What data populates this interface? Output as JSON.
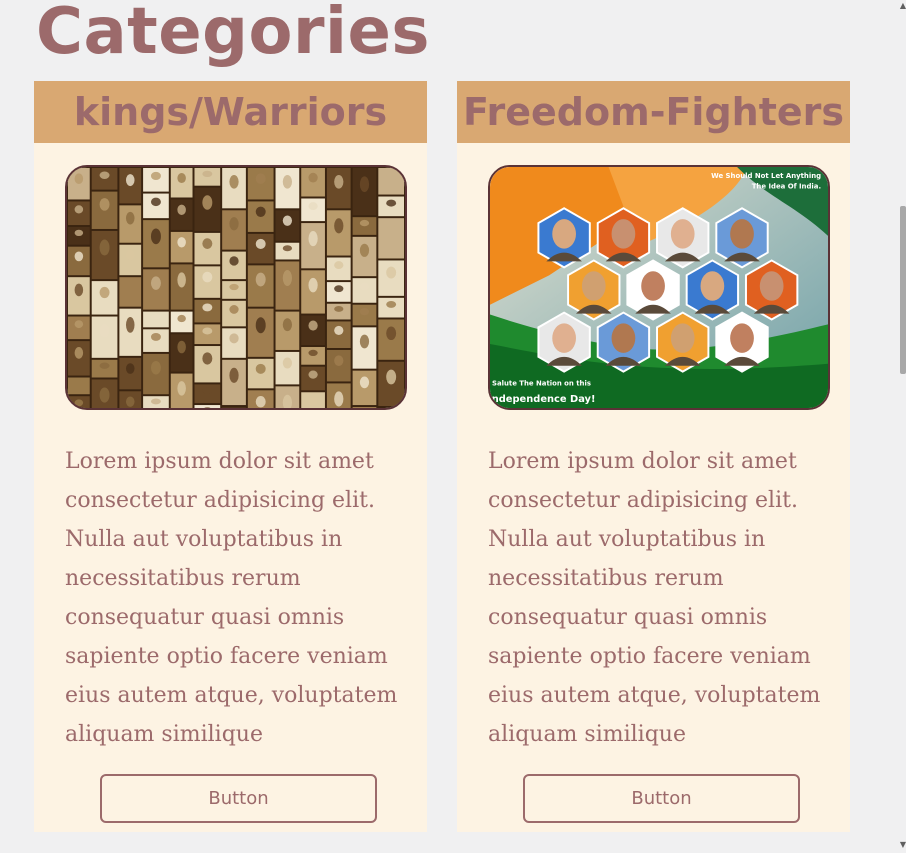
{
  "page": {
    "title": "Categories"
  },
  "cards": [
    {
      "title": "kings/Warriors",
      "image": "kings-warriors-collage",
      "description": "Lorem ipsum dolor sit amet consectetur adipisicing elit. Nulla aut voluptatibus in necessitatibus rerum consequatur quasi omnis sapiente optio facere veniam eius autem atque, voluptatem aliquam similique",
      "button_label": "Button"
    },
    {
      "title": "Freedom-Fighters",
      "image": "freedom-fighters-poster",
      "image_text": {
        "top_line1": "We Should Not Let Anything",
        "top_line2": "The Idea Of India.",
        "bottom_line1": "Salute The Nation on this",
        "bottom_line2": "Independence Day!"
      },
      "description": "Lorem ipsum dolor sit amet consectetur adipisicing elit. Nulla aut voluptatibus in necessitatibus rerum consequatur quasi omnis sapiente optio facere veniam eius autem atque, voluptatem aliquam similique",
      "button_label": "Button"
    }
  ],
  "colors": {
    "accent": "#9c6a6b",
    "card_header": "#d9a872",
    "card_bg": "#fdf3e3",
    "page_bg": "#f0f0f1"
  }
}
